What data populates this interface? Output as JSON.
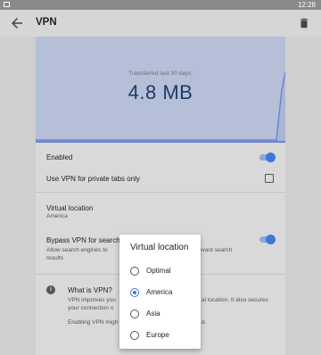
{
  "status_bar": {
    "time": "12:28"
  },
  "app_bar": {
    "title": "VPN",
    "back_icon": "arrow-left-icon",
    "delete_icon": "trash-icon"
  },
  "graph": {
    "label": "Transferred last 30 days:",
    "value": "4.8 MB",
    "fill_color": "#b5bfd8",
    "line_color": "#6a86d4"
  },
  "settings": {
    "enabled": {
      "label": "Enabled",
      "on": true
    },
    "private_tabs": {
      "label": "Use VPN for private tabs only",
      "checked": false
    },
    "virtual_location": {
      "label": "Virtual location",
      "value": "America"
    },
    "bypass": {
      "label": "Bypass VPN for search",
      "desc_left": "Allow search engines to",
      "desc_right": "elevant search",
      "desc_2": "results",
      "on": true
    },
    "what_is": {
      "title": "What is VPN?",
      "line1_left": "VPN improves you",
      "line1_right": "al location. It also secures",
      "line2_left": "your connection o",
      "line3_left": "Enabling VPN migh",
      "line3_right": "d."
    }
  },
  "dialog": {
    "title": "Virtual location",
    "options": [
      {
        "label": "Optimal",
        "selected": false
      },
      {
        "label": "America",
        "selected": true
      },
      {
        "label": "Asia",
        "selected": false
      },
      {
        "label": "Europe",
        "selected": false
      }
    ]
  }
}
